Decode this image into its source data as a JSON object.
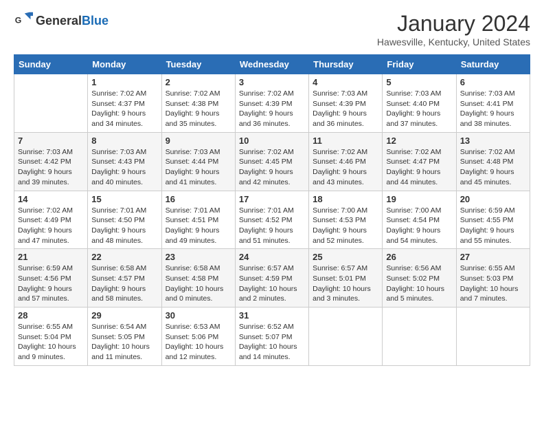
{
  "logo": {
    "general": "General",
    "blue": "Blue"
  },
  "title": "January 2024",
  "location": "Hawesville, Kentucky, United States",
  "days_of_week": [
    "Sunday",
    "Monday",
    "Tuesday",
    "Wednesday",
    "Thursday",
    "Friday",
    "Saturday"
  ],
  "weeks": [
    [
      {
        "day": "",
        "info": ""
      },
      {
        "day": "1",
        "info": "Sunrise: 7:02 AM\nSunset: 4:37 PM\nDaylight: 9 hours\nand 34 minutes."
      },
      {
        "day": "2",
        "info": "Sunrise: 7:02 AM\nSunset: 4:38 PM\nDaylight: 9 hours\nand 35 minutes."
      },
      {
        "day": "3",
        "info": "Sunrise: 7:02 AM\nSunset: 4:39 PM\nDaylight: 9 hours\nand 36 minutes."
      },
      {
        "day": "4",
        "info": "Sunrise: 7:03 AM\nSunset: 4:39 PM\nDaylight: 9 hours\nand 36 minutes."
      },
      {
        "day": "5",
        "info": "Sunrise: 7:03 AM\nSunset: 4:40 PM\nDaylight: 9 hours\nand 37 minutes."
      },
      {
        "day": "6",
        "info": "Sunrise: 7:03 AM\nSunset: 4:41 PM\nDaylight: 9 hours\nand 38 minutes."
      }
    ],
    [
      {
        "day": "7",
        "info": "Sunrise: 7:03 AM\nSunset: 4:42 PM\nDaylight: 9 hours\nand 39 minutes."
      },
      {
        "day": "8",
        "info": "Sunrise: 7:03 AM\nSunset: 4:43 PM\nDaylight: 9 hours\nand 40 minutes."
      },
      {
        "day": "9",
        "info": "Sunrise: 7:03 AM\nSunset: 4:44 PM\nDaylight: 9 hours\nand 41 minutes."
      },
      {
        "day": "10",
        "info": "Sunrise: 7:02 AM\nSunset: 4:45 PM\nDaylight: 9 hours\nand 42 minutes."
      },
      {
        "day": "11",
        "info": "Sunrise: 7:02 AM\nSunset: 4:46 PM\nDaylight: 9 hours\nand 43 minutes."
      },
      {
        "day": "12",
        "info": "Sunrise: 7:02 AM\nSunset: 4:47 PM\nDaylight: 9 hours\nand 44 minutes."
      },
      {
        "day": "13",
        "info": "Sunrise: 7:02 AM\nSunset: 4:48 PM\nDaylight: 9 hours\nand 45 minutes."
      }
    ],
    [
      {
        "day": "14",
        "info": "Sunrise: 7:02 AM\nSunset: 4:49 PM\nDaylight: 9 hours\nand 47 minutes."
      },
      {
        "day": "15",
        "info": "Sunrise: 7:01 AM\nSunset: 4:50 PM\nDaylight: 9 hours\nand 48 minutes."
      },
      {
        "day": "16",
        "info": "Sunrise: 7:01 AM\nSunset: 4:51 PM\nDaylight: 9 hours\nand 49 minutes."
      },
      {
        "day": "17",
        "info": "Sunrise: 7:01 AM\nSunset: 4:52 PM\nDaylight: 9 hours\nand 51 minutes."
      },
      {
        "day": "18",
        "info": "Sunrise: 7:00 AM\nSunset: 4:53 PM\nDaylight: 9 hours\nand 52 minutes."
      },
      {
        "day": "19",
        "info": "Sunrise: 7:00 AM\nSunset: 4:54 PM\nDaylight: 9 hours\nand 54 minutes."
      },
      {
        "day": "20",
        "info": "Sunrise: 6:59 AM\nSunset: 4:55 PM\nDaylight: 9 hours\nand 55 minutes."
      }
    ],
    [
      {
        "day": "21",
        "info": "Sunrise: 6:59 AM\nSunset: 4:56 PM\nDaylight: 9 hours\nand 57 minutes."
      },
      {
        "day": "22",
        "info": "Sunrise: 6:58 AM\nSunset: 4:57 PM\nDaylight: 9 hours\nand 58 minutes."
      },
      {
        "day": "23",
        "info": "Sunrise: 6:58 AM\nSunset: 4:58 PM\nDaylight: 10 hours\nand 0 minutes."
      },
      {
        "day": "24",
        "info": "Sunrise: 6:57 AM\nSunset: 4:59 PM\nDaylight: 10 hours\nand 2 minutes."
      },
      {
        "day": "25",
        "info": "Sunrise: 6:57 AM\nSunset: 5:01 PM\nDaylight: 10 hours\nand 3 minutes."
      },
      {
        "day": "26",
        "info": "Sunrise: 6:56 AM\nSunset: 5:02 PM\nDaylight: 10 hours\nand 5 minutes."
      },
      {
        "day": "27",
        "info": "Sunrise: 6:55 AM\nSunset: 5:03 PM\nDaylight: 10 hours\nand 7 minutes."
      }
    ],
    [
      {
        "day": "28",
        "info": "Sunrise: 6:55 AM\nSunset: 5:04 PM\nDaylight: 10 hours\nand 9 minutes."
      },
      {
        "day": "29",
        "info": "Sunrise: 6:54 AM\nSunset: 5:05 PM\nDaylight: 10 hours\nand 11 minutes."
      },
      {
        "day": "30",
        "info": "Sunrise: 6:53 AM\nSunset: 5:06 PM\nDaylight: 10 hours\nand 12 minutes."
      },
      {
        "day": "31",
        "info": "Sunrise: 6:52 AM\nSunset: 5:07 PM\nDaylight: 10 hours\nand 14 minutes."
      },
      {
        "day": "",
        "info": ""
      },
      {
        "day": "",
        "info": ""
      },
      {
        "day": "",
        "info": ""
      }
    ]
  ]
}
